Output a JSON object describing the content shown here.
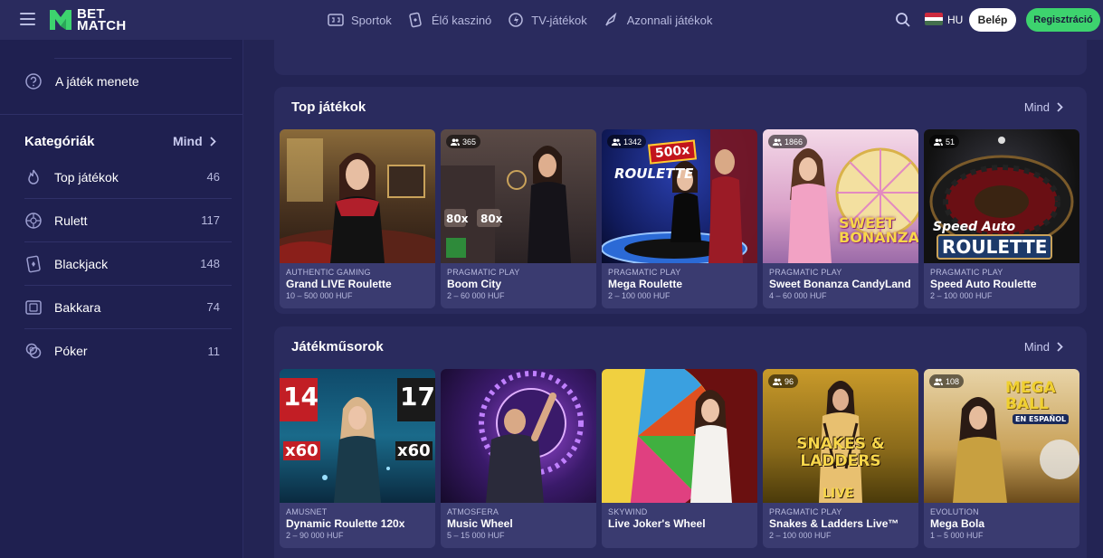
{
  "header": {
    "nav": [
      {
        "label": "Sportok",
        "icon": "scoreboard-icon"
      },
      {
        "label": "Élő kaszinó",
        "icon": "cards-icon"
      },
      {
        "label": "TV-játékok",
        "icon": "tv-games-icon"
      },
      {
        "label": "Azonnali játékok",
        "icon": "rocket-icon"
      }
    ],
    "lang": "HU",
    "login": "Belép",
    "register": "Regisztráció"
  },
  "sidebar": {
    "howto": "A játék menete",
    "categories_title": "Kategóriák",
    "categories_all": "Mind",
    "items": [
      {
        "label": "Top játékok",
        "count": "46",
        "icon": "flame-icon"
      },
      {
        "label": "Rulett",
        "count": "117",
        "icon": "roulette-icon"
      },
      {
        "label": "Blackjack",
        "count": "148",
        "icon": "card-icon"
      },
      {
        "label": "Bakkara",
        "count": "74",
        "icon": "baccarat-icon"
      },
      {
        "label": "Póker",
        "count": "11",
        "icon": "chips-icon"
      }
    ]
  },
  "sections": [
    {
      "title": "Top játékok",
      "all": "Mind",
      "games": [
        {
          "provider": "AUTHENTIC GAMING",
          "name": "Grand LIVE Roulette",
          "limit": "10 – 500 000 HUF",
          "players": ""
        },
        {
          "provider": "PRAGMATIC PLAY",
          "name": "Boom City",
          "limit": "2 – 60 000 HUF",
          "players": "365"
        },
        {
          "provider": "PRAGMATIC PLAY",
          "name": "Mega Roulette",
          "limit": "2 – 100 000 HUF",
          "players": "1342"
        },
        {
          "provider": "PRAGMATIC PLAY",
          "name": "Sweet Bonanza CandyLand",
          "limit": "4 – 60 000 HUF",
          "players": "1866"
        },
        {
          "provider": "PRAGMATIC PLAY",
          "name": "Speed Auto Roulette",
          "limit": "2 – 100 000 HUF",
          "players": "51"
        }
      ]
    },
    {
      "title": "Játékműsorok",
      "all": "Mind",
      "games": [
        {
          "provider": "AMUSNET",
          "name": "Dynamic Roulette 120x",
          "limit": "2 – 90 000 HUF",
          "players": ""
        },
        {
          "provider": "ATMOSFERA",
          "name": "Music Wheel",
          "limit": "5 – 15 000 HUF",
          "players": ""
        },
        {
          "provider": "SKYWIND",
          "name": "Live Joker's Wheel",
          "limit": "",
          "players": ""
        },
        {
          "provider": "PRAGMATIC PLAY",
          "name": "Snakes & Ladders Live™",
          "limit": "2 – 100 000 HUF",
          "players": "96"
        },
        {
          "provider": "EVOLUTION",
          "name": "Mega Bola",
          "limit": "1 – 5 000 HUF",
          "players": "108"
        }
      ]
    }
  ],
  "thumb_text": {
    "boom_mult": "80x",
    "mega_badge": "500x",
    "mega_logo": "ROULETTE",
    "sweet_logo": "SWEET BONANZA",
    "speed_logo_1": "Speed Auto",
    "speed_logo_2": "ROULETTE",
    "dyn_left": "14",
    "dyn_right": "17",
    "dyn_mult": "x60",
    "snakes_logo": "SNAKES & LADDERS",
    "snakes_live": "LIVE",
    "megaball_logo": "MEGA BALL",
    "megaball_sub": "EN ESPAÑOL"
  }
}
